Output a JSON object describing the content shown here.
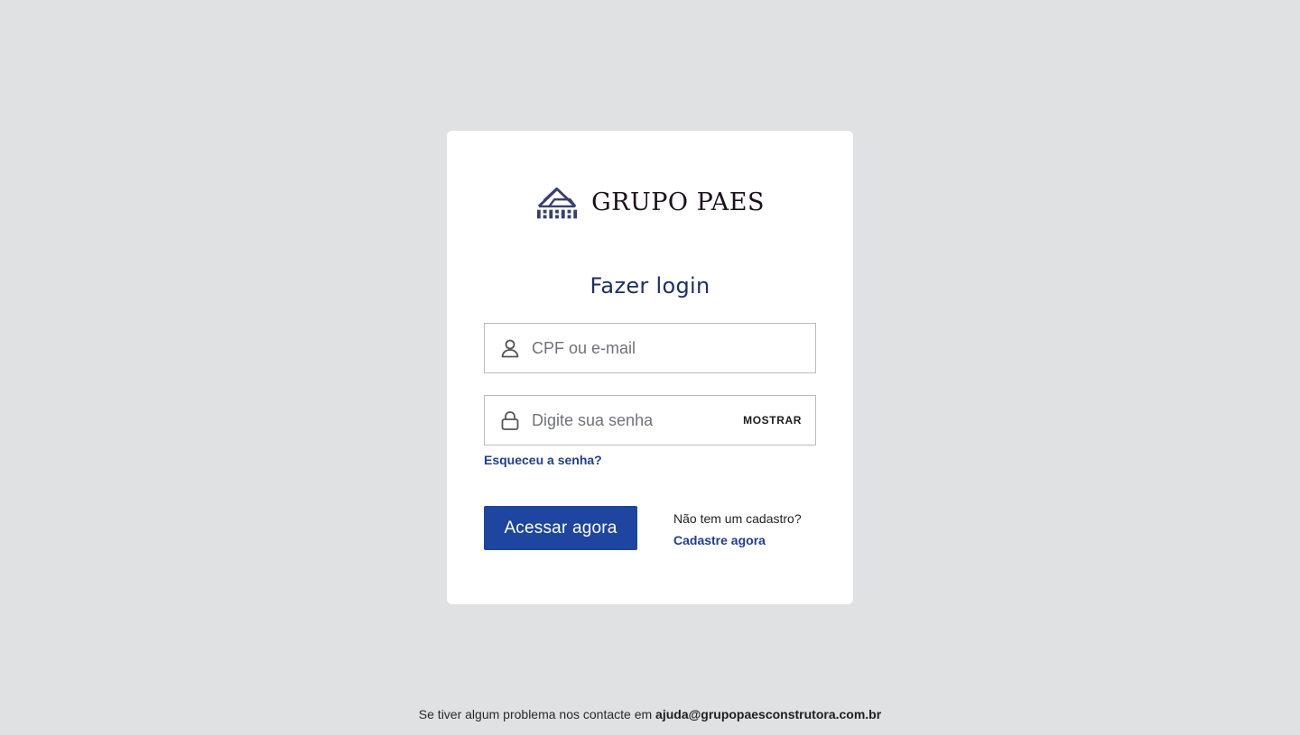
{
  "brand": {
    "name": "GRUPO PAES",
    "logo_icon": "house-roof-logo-icon",
    "color": "#3a3f73"
  },
  "form": {
    "title": "Fazer login",
    "username": {
      "placeholder": "CPF ou e-mail",
      "value": "",
      "icon": "user-icon"
    },
    "password": {
      "placeholder": "Digite sua senha",
      "value": "",
      "icon": "lock-icon",
      "show_label": "MOSTRAR"
    },
    "forgot_label": "Esqueceu a senha?",
    "submit_label": "Acessar agora",
    "signup_question": "Não tem um cadastro?",
    "signup_link": "Cadastre agora"
  },
  "footer": {
    "text": "Se tiver algum problema nos contacte em ",
    "email": "ajuda@grupopaesconstrutora.com.br"
  },
  "colors": {
    "background": "#e0e1e3",
    "card": "#ffffff",
    "primary": "#1e46a0",
    "link": "#1e3f8f",
    "title": "#1e2e66"
  }
}
